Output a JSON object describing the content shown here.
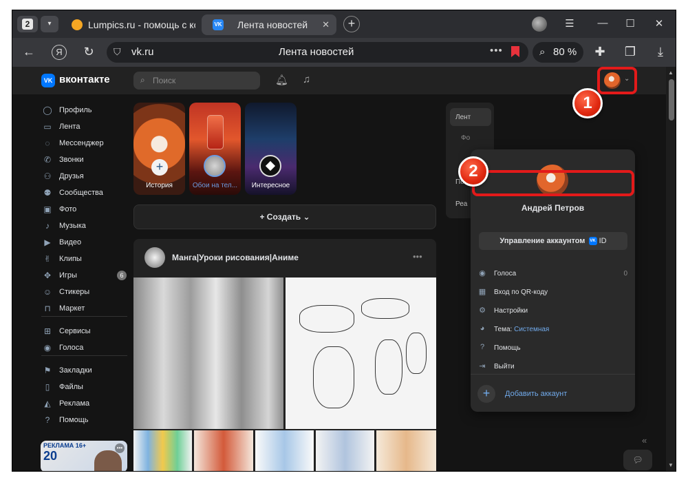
{
  "browser": {
    "tab_count": "2",
    "tabs": [
      {
        "title": "Lumpics.ru - помощь с ком"
      },
      {
        "title": "Лента новостей"
      }
    ],
    "address": {
      "domain": "vk.ru",
      "page_title": "Лента новостей",
      "zoom": "80 %"
    }
  },
  "vk": {
    "brand": "вконтакте",
    "search_placeholder": "Поиск",
    "sidebar": {
      "items": [
        {
          "label": "Профиль",
          "icon": "user-icon"
        },
        {
          "label": "Лента",
          "icon": "feed-icon"
        },
        {
          "label": "Мессенджер",
          "icon": "message-icon"
        },
        {
          "label": "Звонки",
          "icon": "phone-icon"
        },
        {
          "label": "Друзья",
          "icon": "friends-icon"
        },
        {
          "label": "Сообщества",
          "icon": "groups-icon"
        },
        {
          "label": "Фото",
          "icon": "photo-icon"
        },
        {
          "label": "Музыка",
          "icon": "music-icon"
        },
        {
          "label": "Видео",
          "icon": "video-icon"
        },
        {
          "label": "Клипы",
          "icon": "clips-icon"
        },
        {
          "label": "Игры",
          "icon": "games-icon",
          "badge": "6"
        },
        {
          "label": "Стикеры",
          "icon": "stickers-icon"
        },
        {
          "label": "Маркет",
          "icon": "market-icon"
        }
      ],
      "items2": [
        {
          "label": "Сервисы",
          "icon": "services-icon"
        },
        {
          "label": "Голоса",
          "icon": "votes-icon"
        }
      ],
      "items3": [
        {
          "label": "Закладки",
          "icon": "bookmark-icon"
        },
        {
          "label": "Файлы",
          "icon": "file-icon"
        },
        {
          "label": "Реклама",
          "icon": "ads-icon"
        },
        {
          "label": "Помощь",
          "icon": "help-icon"
        }
      ],
      "ad": {
        "tag": "РЕКЛАМА 16+",
        "number": "20"
      }
    },
    "stories": [
      {
        "label": "История"
      },
      {
        "label": "Обои на тел..."
      },
      {
        "label": "Интересное"
      }
    ],
    "create_label": "Создать",
    "post": {
      "author": "Манга|Уроки рисования|Аниме"
    },
    "right_menu": {
      "items": [
        "Лент",
        "Фо",
        "По",
        "Реа"
      ]
    },
    "account_menu": {
      "name": "Андрей Петров",
      "manage_label": "Управление аккаунтом",
      "manage_vk": "VK",
      "manage_id": "ID",
      "items": [
        {
          "label": "Голоса",
          "icon": "votes-icon",
          "count": "0"
        },
        {
          "label": "Вход по QR-коду",
          "icon": "qr-icon"
        },
        {
          "label": "Настройки",
          "icon": "gear-icon"
        },
        {
          "label": "Тема:",
          "icon": "palette-icon",
          "value": "Системная"
        },
        {
          "label": "Помощь",
          "icon": "help-icon"
        },
        {
          "label": "Выйти",
          "icon": "logout-icon"
        }
      ],
      "add_account": "Добавить аккаунт"
    }
  },
  "callouts": [
    {
      "number": "1"
    },
    {
      "number": "2"
    }
  ],
  "colors": {
    "highlight": "#e31a1a",
    "vk_blue": "#0077ff",
    "link": "#71aaeb"
  }
}
